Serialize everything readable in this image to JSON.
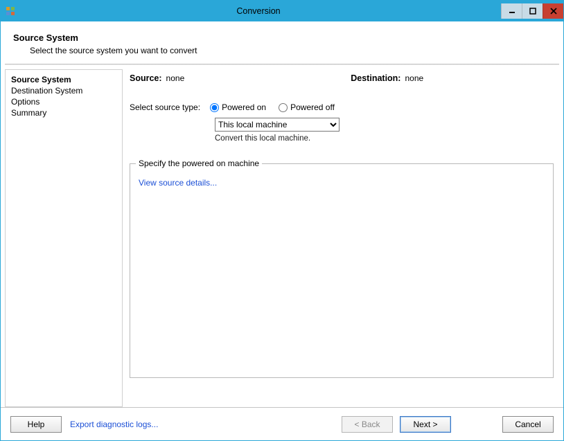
{
  "window": {
    "title": "Conversion"
  },
  "header": {
    "title": "Source System",
    "subtitle": "Select the source system you want to convert"
  },
  "sidebar": {
    "items": [
      {
        "label": "Source System",
        "active": true
      },
      {
        "label": "Destination System",
        "active": false
      },
      {
        "label": "Options",
        "active": false
      },
      {
        "label": "Summary",
        "active": false
      }
    ]
  },
  "main": {
    "source_label": "Source:",
    "source_value": "none",
    "destination_label": "Destination:",
    "destination_value": "none",
    "select_source_type_label": "Select source type:",
    "radio_powered_on": "Powered on",
    "radio_powered_off": "Powered off",
    "dropdown_selected": "This local machine",
    "helper_text": "Convert this local machine.",
    "fieldset_legend": "Specify the powered on machine",
    "view_details_link": "View source details..."
  },
  "footer": {
    "help": "Help",
    "export_logs": "Export diagnostic logs...",
    "back": "< Back",
    "next": "Next >",
    "cancel": "Cancel"
  }
}
